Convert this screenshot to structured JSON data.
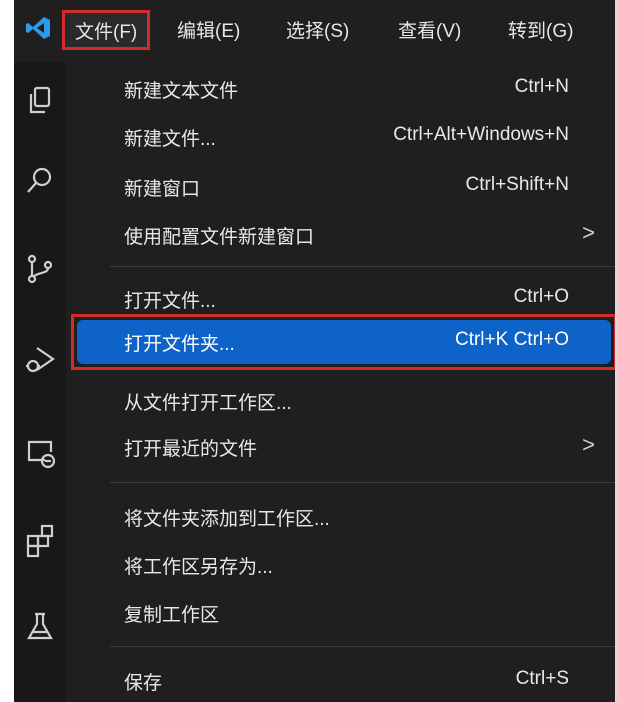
{
  "menubar": {
    "items": [
      "文件(F)",
      "编辑(E)",
      "选择(S)",
      "查看(V)",
      "转到(G)"
    ]
  },
  "activity_icons": [
    "explorer-icon",
    "search-icon",
    "source-control-icon",
    "run-debug-icon",
    "remote-explorer-icon",
    "extensions-icon",
    "testing-icon"
  ],
  "file_menu": {
    "groups": [
      [
        {
          "label": "新建文本文件",
          "shortcut": "Ctrl+N"
        },
        {
          "label": "新建文件...",
          "shortcut": "Ctrl+Alt+Windows+N"
        },
        {
          "label": "新建窗口",
          "shortcut": "Ctrl+Shift+N"
        },
        {
          "label": "使用配置文件新建窗口",
          "submenu": ">"
        }
      ],
      [
        {
          "label": "打开文件...",
          "shortcut": "Ctrl+O"
        },
        {
          "label": "打开文件夹...",
          "shortcut": "Ctrl+K Ctrl+O",
          "highlighted": true
        },
        {
          "label": "从文件打开工作区..."
        },
        {
          "label": "打开最近的文件",
          "submenu": ">"
        }
      ],
      [
        {
          "label": "将文件夹添加到工作区..."
        },
        {
          "label": "将工作区另存为..."
        },
        {
          "label": "复制工作区"
        }
      ],
      [
        {
          "label": "保存",
          "shortcut": "Ctrl+S"
        }
      ]
    ]
  },
  "colors": {
    "highlight": "#0e63c8",
    "annotation": "#d22b2b",
    "background": "#1f1f1f"
  }
}
